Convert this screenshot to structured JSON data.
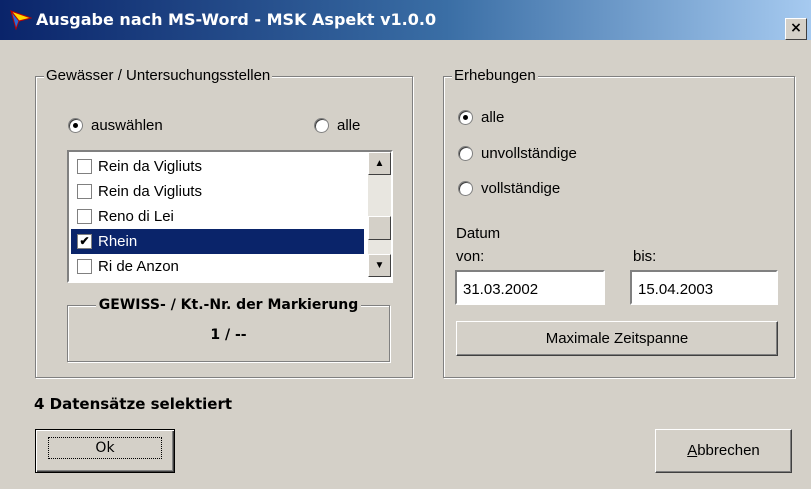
{
  "window": {
    "title": "Ausgabe nach MS-Word - MSK Aspekt v1.0.0",
    "close_glyph": "×"
  },
  "gewaesser": {
    "legend": "Gewässer / Untersuchungsstellen",
    "radio_select": "auswählen",
    "radio_all": "alle",
    "list_items": [
      {
        "label": "Rein da Vigliuts",
        "checked": false,
        "selected": false
      },
      {
        "label": "Rein da Vigliuts",
        "checked": false,
        "selected": false
      },
      {
        "label": "Reno di Lei",
        "checked": false,
        "selected": false
      },
      {
        "label": "Rhein",
        "checked": true,
        "selected": true
      },
      {
        "label": "Ri de Anzon",
        "checked": false,
        "selected": false
      }
    ],
    "marker_legend": "GEWISS- / Kt.-Nr. der Markierung",
    "marker_value": "1 / --"
  },
  "erhebungen": {
    "legend": "Erhebungen",
    "radio_all": "alle",
    "radio_incomplete": "unvollständige",
    "radio_complete": "vollständige",
    "date_label": "Datum",
    "from_label": "von:",
    "to_label": "bis:",
    "from_value": "31.03.2002",
    "to_value": "15.04.2003",
    "max_span_button": "Maximale Zeitspanne"
  },
  "status": "4 Datensätze selektiert",
  "buttons": {
    "ok": "Ok",
    "cancel": "Abbrechen"
  }
}
